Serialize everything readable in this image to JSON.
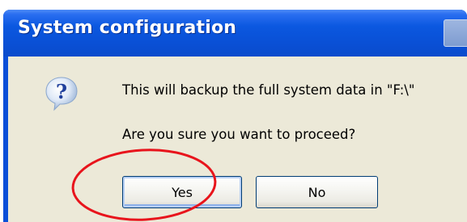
{
  "dialog": {
    "title": "System configuration",
    "icon": "question-icon",
    "message_line1": "This will backup the full system data in \"F:\\\"",
    "message_line2": "Are you sure you want to proceed?",
    "buttons": {
      "yes_label": "Yes",
      "no_label": "No"
    },
    "default_button": "Yes"
  },
  "annotation": {
    "shape": "ellipse",
    "target": "Yes",
    "color": "#e8141c"
  },
  "colors": {
    "titlebar": "#0a50d6",
    "dialog_body": "#ece9d8",
    "button_border": "#003c74"
  }
}
